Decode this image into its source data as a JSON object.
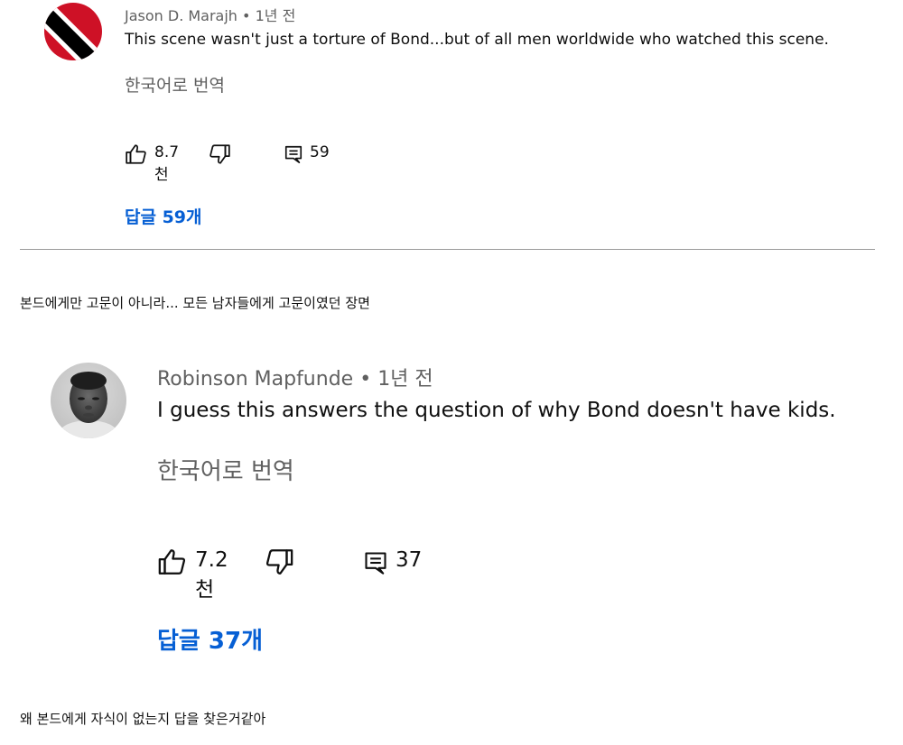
{
  "comments": [
    {
      "author": "Jason D. Marajh",
      "separator": "•",
      "time": "1년 전",
      "text": "This scene wasn't just a torture of Bond...but of all men worldwide who watched this scene.",
      "translate_label": "한국어로 번역",
      "like_count": "8.7천",
      "reply_count": "59",
      "replies_link": "답글 59개",
      "avatar_icon": "trinidad-flag-avatar",
      "avatar_colors": [
        "#ce1126",
        "#ffffff",
        "#000000"
      ]
    },
    {
      "author": "Robinson Mapfunde",
      "separator": "•",
      "time": "1년 전",
      "text": "I guess this answers the question of why Bond doesn't have kids.",
      "translate_label": "한국어로 번역",
      "like_count": "7.2천",
      "reply_count": "37",
      "replies_link": "답글 37개",
      "avatar_icon": "grayscale-portrait-avatar"
    }
  ],
  "captions": [
    "본드에게만 고문이 아니라... 모든 남자들에게 고문이였던 장면",
    "왜 본드에게 자식이 없는지 답을 찾은거같아"
  ],
  "colors": {
    "link_blue": "#065fd4",
    "secondary_text": "#606060",
    "primary_text": "#0f0f0f"
  }
}
